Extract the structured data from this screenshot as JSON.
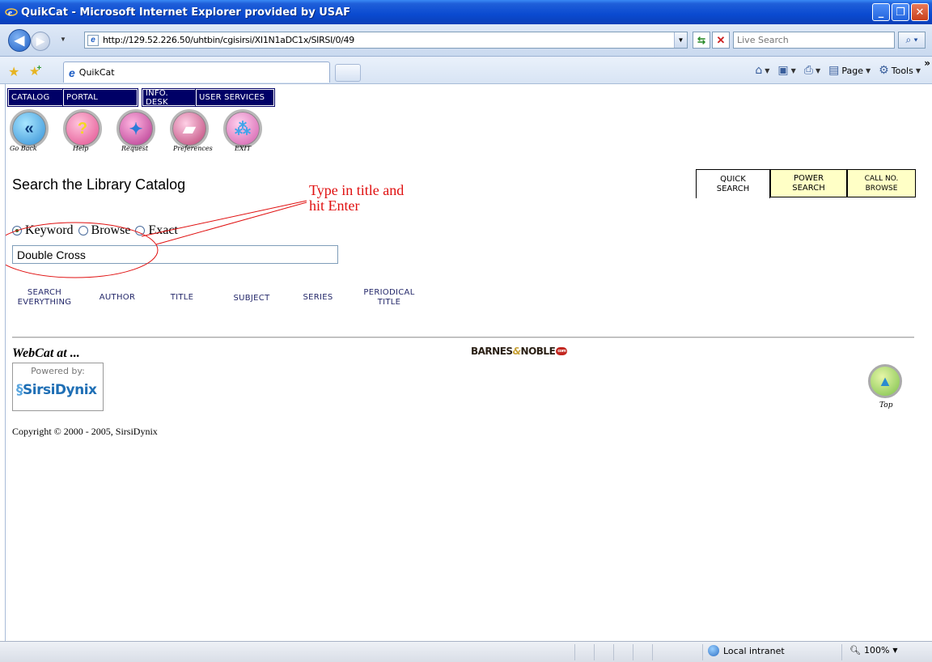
{
  "window": {
    "title": "QuikCat - Microsoft Internet Explorer provided by USAF",
    "minimize_glyph": "_",
    "maximize_glyph": "❐",
    "close_glyph": "✕"
  },
  "addressbar": {
    "url": "http://129.52.226.50/uhtbin/cgisirsi/XI1N1aDC1x/SIRSI/0/49",
    "search_placeholder": "Live Search"
  },
  "tabs": [
    {
      "label": "QuikCat"
    }
  ],
  "commandbar": {
    "page_label": "Page",
    "tools_label": "Tools"
  },
  "library_nav": {
    "catalog": "CATALOG",
    "portal": "PORTAL",
    "info_desk": "INFO. DESK",
    "user_services": "USER SERVICES"
  },
  "tool_icons": [
    {
      "name": "go-back",
      "label": "Go Back",
      "icon": "back-arrows-icon"
    },
    {
      "name": "help",
      "label": "Help",
      "icon": "question-mark-icon"
    },
    {
      "name": "request",
      "label": "Request",
      "icon": "request-icon"
    },
    {
      "name": "preferences",
      "label": "Preferences",
      "icon": "preferences-book-icon"
    },
    {
      "name": "exit",
      "label": "EXIT",
      "icon": "footprints-icon"
    }
  ],
  "page": {
    "heading": "Search the Library Catalog",
    "annotation_line1": "Type in title and",
    "annotation_line2": "hit Enter",
    "annotation_color": "#e01010"
  },
  "search_tabs": {
    "quick": [
      "QUICK",
      "SEARCH"
    ],
    "power": [
      "POWER",
      "SEARCH"
    ],
    "callno": [
      "CALL NO.",
      "BROWSE"
    ]
  },
  "search_type": {
    "options": [
      "Keyword",
      "Browse",
      "Exact"
    ],
    "selected": "Keyword"
  },
  "search_input": {
    "value": "Double Cross"
  },
  "search_links": {
    "everything": [
      "SEARCH",
      "EVERYTHING"
    ],
    "author": "AUTHOR",
    "title": "TITLE",
    "subject": "SUBJECT",
    "series": "SERIES",
    "periodical": [
      "PERIODICAL",
      "TITLE"
    ]
  },
  "footer": {
    "webcat": "WebCat at ...",
    "bn_part1": "BARNES",
    "bn_amp": "&",
    "bn_part2": "NOBLE",
    "bn_com": "com",
    "powered_by": "Powered by:",
    "brand": "SirsiDynix",
    "top_label": "Top",
    "copyright": "Copyright © 2000 - 2005, SirsiDynix"
  },
  "statusbar": {
    "zone": "Local intranet",
    "zoom": "100%"
  },
  "colors": {
    "nav_bg": "#000066",
    "tab_bg": "#ffffc6",
    "link_color": "#24286a"
  }
}
